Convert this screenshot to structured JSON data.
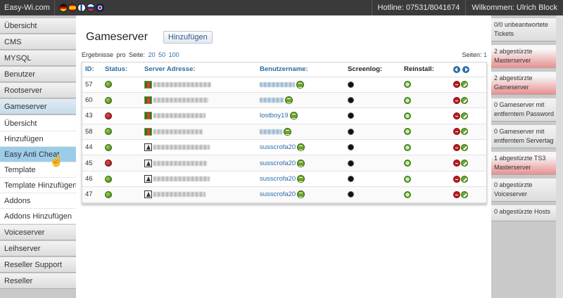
{
  "topbar": {
    "brand": "Easy-Wi.com",
    "flags": [
      "de-flag",
      "es-flag",
      "fi-flag",
      "ru-flag",
      "uk-flag"
    ],
    "hotline": "Hotline: 07531/8041674",
    "welcome": "Wilkommen: Ulrich Block"
  },
  "sidebar": {
    "items": [
      {
        "label": "Übersicht"
      },
      {
        "label": "CMS"
      },
      {
        "label": "MYSQL"
      },
      {
        "label": "Benutzer"
      },
      {
        "label": "Rootserver"
      },
      {
        "label": "Gameserver"
      }
    ],
    "subitems": [
      {
        "label": "Übersicht"
      },
      {
        "label": "Hinzufügen"
      },
      {
        "label": "Easy Anti Cheat"
      },
      {
        "label": "Template"
      },
      {
        "label": "Template Hinzufügen"
      },
      {
        "label": "Addons"
      },
      {
        "label": "Addons Hinzufügen"
      }
    ],
    "items_after": [
      {
        "label": "Voiceserver"
      },
      {
        "label": "Leihserver"
      },
      {
        "label": "Reseller Support"
      },
      {
        "label": "Reseller"
      }
    ]
  },
  "main": {
    "title": "Gameserver",
    "add_button": "Hinzufügen",
    "results_label": "Ergebnisse pro Seite:",
    "per_page": [
      "20",
      "50",
      "100"
    ],
    "pages_label": "Seiten:",
    "page": "1",
    "columns": {
      "id": "ID:",
      "status": "Status:",
      "address": "Server Adresse:",
      "user": "Benutzername:",
      "screenlog": "Screenlog:",
      "reinstall": "Reinstall:"
    },
    "rows": [
      {
        "id": "57",
        "status": "green",
        "game": "cs",
        "user": ""
      },
      {
        "id": "60",
        "status": "green",
        "game": "cs",
        "user": ""
      },
      {
        "id": "43",
        "status": "red",
        "game": "cs",
        "user": "lostboy19"
      },
      {
        "id": "58",
        "status": "green",
        "game": "cs",
        "user": ""
      },
      {
        "id": "44",
        "status": "green",
        "game": "l4d",
        "user": "susscrofa20"
      },
      {
        "id": "45",
        "status": "red",
        "game": "l4d",
        "user": "susscrofa20"
      },
      {
        "id": "46",
        "status": "green",
        "game": "l4d",
        "user": "susscrofa20"
      },
      {
        "id": "47",
        "status": "green",
        "game": "l4d",
        "user": "susscrofa20"
      }
    ]
  },
  "rightbar": {
    "tickets": [
      {
        "text": "0/0 unbeantwortete Tickets",
        "alert": false
      },
      {
        "text": "2 abgestürzte Masterserver",
        "alert": true
      },
      {
        "text": "2 abgestürzte Gameserver",
        "alert": true
      },
      {
        "text": "0 Gameserver mit entferntem Password",
        "alert": false
      },
      {
        "text": "0 Gameserver mit entferntem Servertag",
        "alert": false
      },
      {
        "text": "1 abgestürzte TS3 Masterserver",
        "alert": true
      },
      {
        "text": "0 abgestürzte Voiceserver",
        "alert": false
      },
      {
        "text": "0 abgestürzte Hosts",
        "alert": false
      }
    ]
  },
  "colors": {
    "topbar": "#3a3a3a",
    "link": "#2a6da8",
    "selected": "#9ccde8",
    "status_green": "#4f8a1c",
    "status_red": "#a31414"
  }
}
